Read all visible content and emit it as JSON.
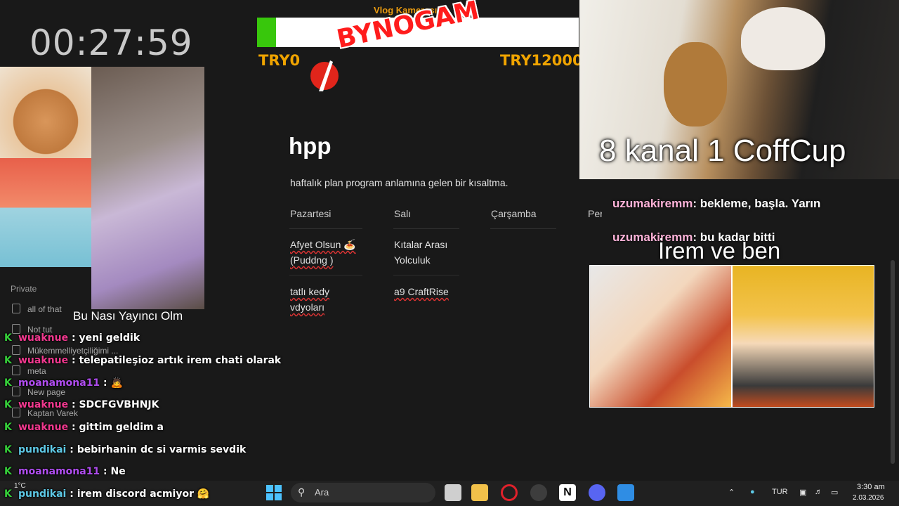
{
  "stream": {
    "timer": "00:27:59",
    "left_caption": "Bu Nası Yayıncı Olm",
    "webcam_caption": "8 kanal 1 CoffCup",
    "right_caption": "İrem ve ben"
  },
  "donation_goal": {
    "title": "Vlog Kamerası",
    "sticker_text": "BYNOGAM",
    "min_label": "TRY0",
    "max_label": "TRY12000",
    "progress_fraction": 0.06
  },
  "sidebar": {
    "section_label": "Private",
    "items": [
      {
        "label": "all of that"
      },
      {
        "label": "Not tut"
      },
      {
        "label": "Mükemmelliyetçiliğimi ..."
      },
      {
        "label": "meta"
      },
      {
        "label": "New page"
      },
      {
        "label": "Kaptan Varek"
      }
    ]
  },
  "notion_page": {
    "title": "hpp",
    "description": "haftalık plan program anlamına gelen bir kısaltma.",
    "columns": [
      "Pazartesi",
      "Salı",
      "Çarşamba",
      "Per"
    ],
    "cells": {
      "mon_1_line1": "Afyet Olsun 🍝",
      "mon_1_line2": "(Puddng )",
      "mon_2_line1": "tatlı kedy",
      "mon_2_line2": "vdyoları",
      "tue_1_line1": "Kıtalar Arası",
      "tue_1_line2": "Yolculuk",
      "tue_2_line1": "a9 CraftRise"
    }
  },
  "chat_left": [
    {
      "user": "wuaknue",
      "message": ": yeni geldik"
    },
    {
      "user": "wuaknue",
      "message": ": telepatileşioz artık irem chati olarak"
    },
    {
      "user": "moanamona11",
      "message": ": 🙇"
    },
    {
      "user": "wuaknue",
      "message": ": SDCFGVBHNJK"
    },
    {
      "user": "wuaknue",
      "message": ": gittim geldim a"
    },
    {
      "user": "pundikai",
      "message": ": bebirhanin dc si varmis sevdik"
    },
    {
      "user": "moanamona11",
      "message": ": Ne"
    },
    {
      "user": "pundikai",
      "message": ": irem discord acmiyor 🤗"
    }
  ],
  "chat_right": [
    {
      "user": "uzumakiremm",
      "message": ": bekleme, başla. Yarın"
    },
    {
      "user": "uzumakiremm",
      "message": ": bu kadar bitti"
    }
  ],
  "taskbar": {
    "search_placeholder": "Ara",
    "weather": "1°C",
    "language": "TUR",
    "time": "3:30 am",
    "date": "2.03.2026"
  },
  "colors": {
    "goal_text": "#f0a400",
    "progress_fill": "#38c70c",
    "chat_user_pink": "#f0388e",
    "chat_user_purple": "#b04df0",
    "chat_user_cyan": "#5ec9e6"
  }
}
